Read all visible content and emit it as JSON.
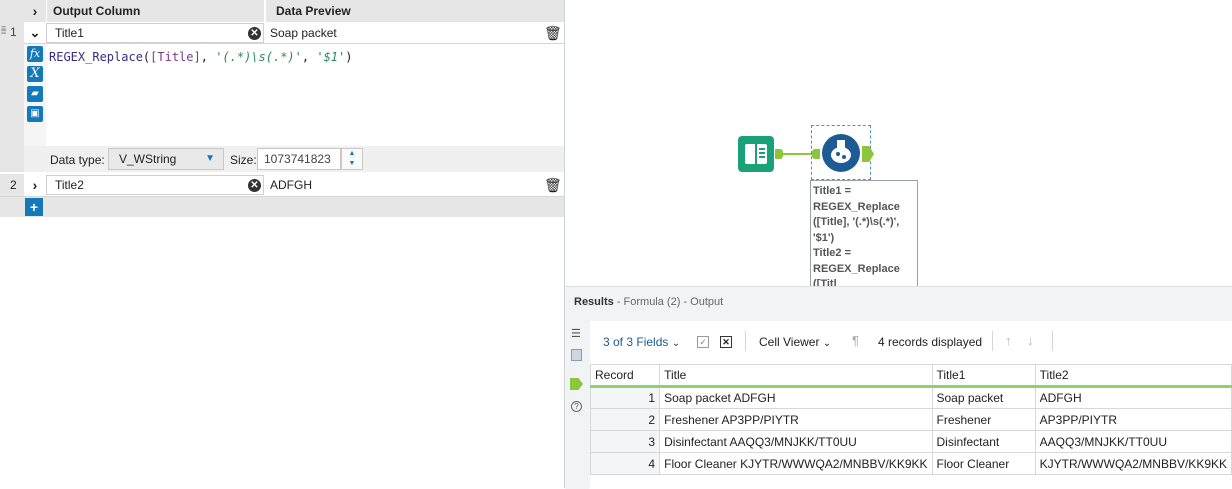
{
  "formula_panel": {
    "header": {
      "output_column": "Output Column",
      "data_preview": "Data Preview"
    },
    "rows": [
      {
        "index": "1",
        "name": "Title1",
        "preview": "Soap packet",
        "expanded": true
      },
      {
        "index": "2",
        "name": "Title2",
        "preview": "ADFGH",
        "expanded": false
      }
    ],
    "expression": {
      "func": "REGEX_Replace",
      "open": "(",
      "field": "[Title]",
      "sep1": ", ",
      "pattern": "'(.*)\\s(.*)'",
      "sep2": ", ",
      "replacement": "'$1'",
      "close": ")"
    },
    "data_type_label": "Data type:",
    "data_type_value": "V_WString",
    "size_label": "Size:",
    "size_value": "1073741823"
  },
  "canvas": {
    "annotation_lines": [
      "Title1 =",
      "REGEX_Replace",
      "([Title], '(.*)\\s(.*)',",
      "'$1')",
      "Title2 =",
      "REGEX_Replace",
      "([Titl"
    ]
  },
  "results": {
    "title": "Results",
    "subtitle": "- Formula (2) - Output",
    "fields_selector": "3 of 3 Fields",
    "cell_viewer": "Cell Viewer",
    "records_displayed": "4 records displayed",
    "columns": [
      "Record",
      "Title",
      "Title1",
      "Title2"
    ],
    "rows": [
      {
        "record": "1",
        "title": "Soap packet ADFGH",
        "title1": "Soap packet",
        "title2": "ADFGH"
      },
      {
        "record": "2",
        "title": "Freshener AP3PP/PIYTR",
        "title1": "Freshener",
        "title2": "AP3PP/PIYTR"
      },
      {
        "record": "3",
        "title": "Disinfectant AAQQ3/MNJKK/TT0UU",
        "title1": "Disinfectant",
        "title2": "AAQQ3/MNJKK/TT0UU"
      },
      {
        "record": "4",
        "title": "Floor Cleaner KJYTR/WWWQA2/MNBBV/KK9KK",
        "title1": "Floor Cleaner",
        "title2": "KJYTR/WWWQA2/MNBBV/KK9KK"
      }
    ]
  },
  "colors": {
    "accent": "#1479b9",
    "connector": "#8cc63f",
    "header_green": "#8fd16a"
  }
}
